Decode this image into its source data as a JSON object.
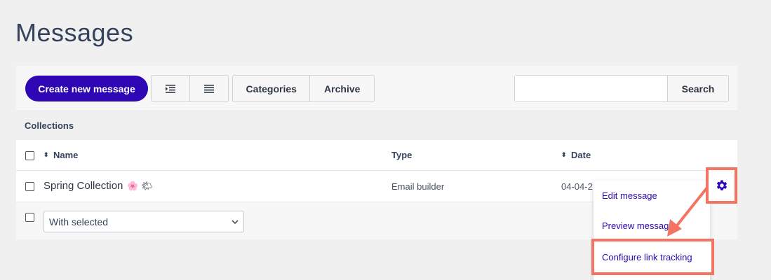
{
  "page": {
    "title": "Messages"
  },
  "toolbar": {
    "create_label": "Create new message",
    "categories_label": "Categories",
    "archive_label": "Archive",
    "search_placeholder": "",
    "search_label": "Search",
    "view_icons": [
      "indent-list-icon",
      "list-icon"
    ]
  },
  "collections": {
    "label": "Collections"
  },
  "table": {
    "columns": [
      {
        "label": "Name",
        "sortable": true
      },
      {
        "label": "Type",
        "sortable": false
      },
      {
        "label": "Date",
        "sortable": true
      }
    ],
    "rows": [
      {
        "name": "Spring Collection",
        "emojis": "🌸 🌤",
        "type": "Email builder",
        "date": "04-04-2"
      }
    ],
    "bulk_select": {
      "selected": "With selected"
    }
  },
  "actions_menu": {
    "icon": "gear-icon",
    "items": [
      "Edit message",
      "Preview message",
      "Configure link tracking"
    ]
  },
  "colors": {
    "primary": "#2e06b4",
    "highlight": "#f47463",
    "background": "#f0f0f0"
  }
}
